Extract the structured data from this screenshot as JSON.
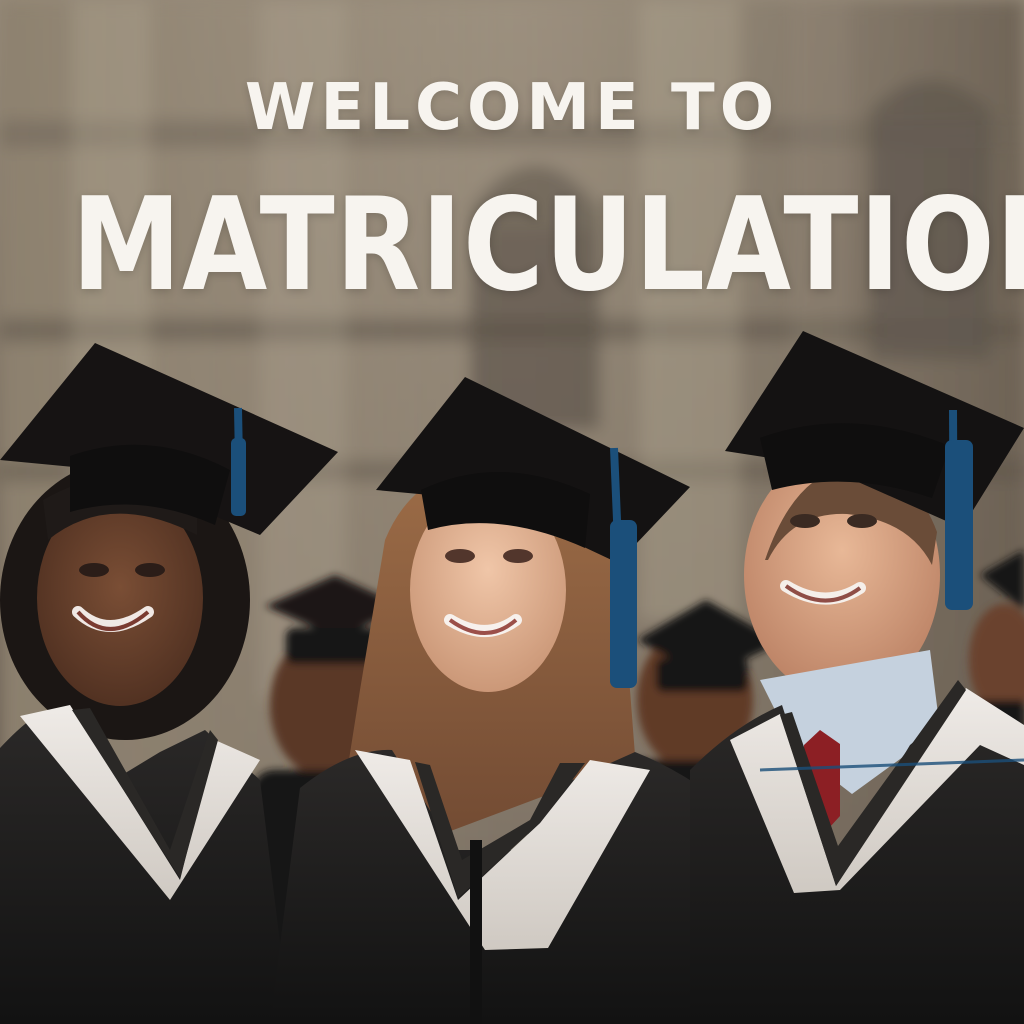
{
  "poster": {
    "headline": {
      "line1": "WELCOME TO",
      "line2": "MATRICULATION"
    }
  },
  "palette": {
    "building": "#8b7f70",
    "building_shadow": "#5a5047",
    "gown": "#1f1d1c",
    "hood": "#e2ded8",
    "tassel": "#1b4f7a",
    "tie": "#8c1f24",
    "shirt": "#c5d1de",
    "skin_dark": "#6a442e",
    "skin_light": "#e0b090",
    "hair_dark": "#1b1614",
    "hair_light": "#8d6242"
  },
  "icons": {
    "cap": "mortarboard-cap-icon"
  }
}
